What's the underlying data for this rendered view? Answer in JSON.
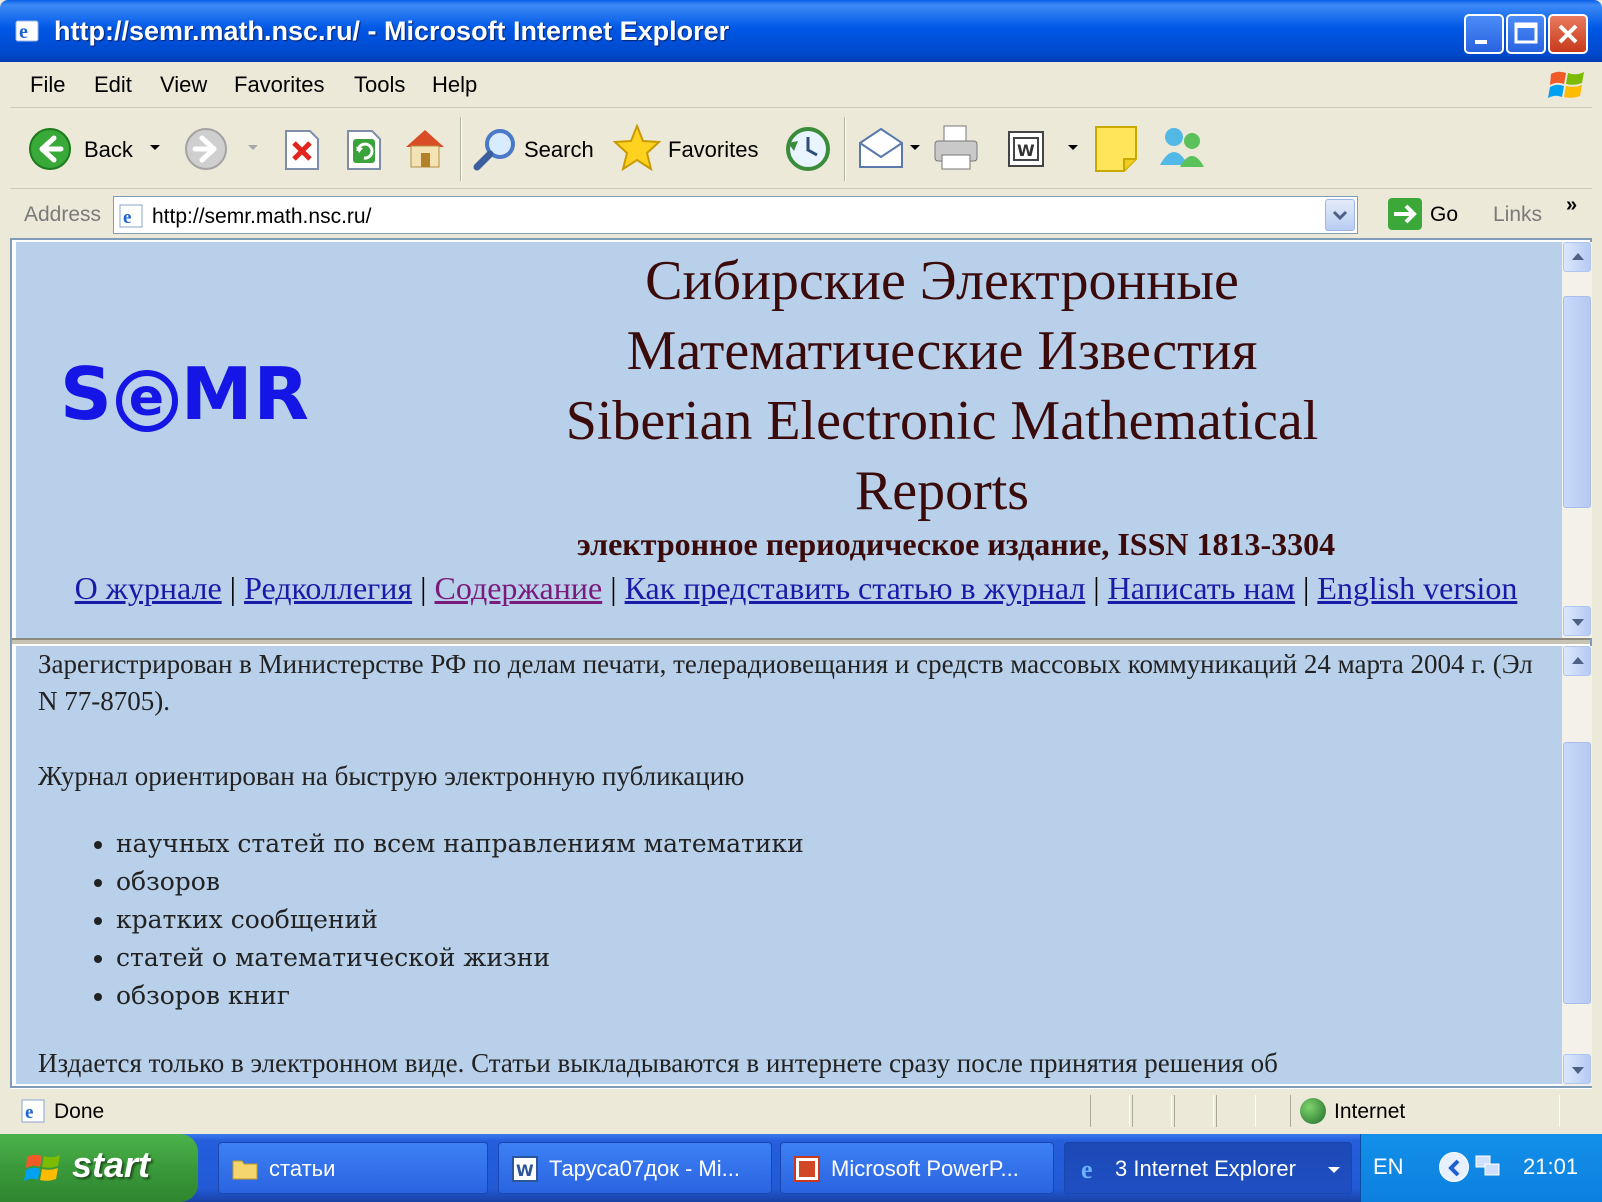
{
  "window": {
    "title": "http://semr.math.nsc.ru/ - Microsoft Internet Explorer"
  },
  "menu": [
    "File",
    "Edit",
    "View",
    "Favorites",
    "Tools",
    "Help"
  ],
  "toolbar": {
    "back_label": "Back",
    "search_label": "Search",
    "favorites_label": "Favorites"
  },
  "address": {
    "label": "Address",
    "url": "http://semr.math.nsc.ru/",
    "go_label": "Go",
    "links_label": "Links",
    "chevron": "»"
  },
  "header": {
    "logo_pre": "S",
    "logo_e": "e",
    "logo_post": "MR",
    "title_lines": [
      "Сибирские Электронные",
      "Математические Известия",
      "Siberian Electronic Mathematical",
      "Reports"
    ],
    "issn": "электронное периодическое издание, ISSN 1813-3304",
    "nav": [
      {
        "label": "О журнале",
        "visited": false
      },
      {
        "label": "Редколлегия",
        "visited": false
      },
      {
        "label": "Содержание",
        "visited": true
      },
      {
        "label": "Как представить статью в журнал",
        "visited": false
      },
      {
        "label": "Написать нам",
        "visited": false
      },
      {
        "label": "English version",
        "visited": false
      }
    ],
    "separator": "|"
  },
  "body": {
    "registration": "Зарегистрирован в Министерстве РФ по делам печати, телерадиовещания и средств массовых коммуникаций 24 марта 2004 г. (Эл N 77-8705).",
    "intro": "Журнал ориентирован на быструю электронную публикацию",
    "items": [
      "научных статей по всем направлениям математики",
      "обзоров",
      "кратких сообщений",
      "статей о математической жизни",
      "обзоров книг"
    ],
    "cut_line": "Издается только в электронном виде. Статьи выкладываются в интернете сразу после принятия решения об"
  },
  "status": {
    "text": "Done",
    "zone": "Internet"
  },
  "taskbar": {
    "start_label": "start",
    "tasks": [
      {
        "label": "статьи",
        "icon": "folder-icon"
      },
      {
        "label": "Таруса07док - Mi...",
        "icon": "word-icon"
      },
      {
        "label": "Microsoft PowerP...",
        "icon": "powerpoint-icon"
      },
      {
        "label": "3 Internet Explorer",
        "icon": "ie-icon"
      }
    ],
    "language": "EN",
    "clock": "21:01"
  }
}
